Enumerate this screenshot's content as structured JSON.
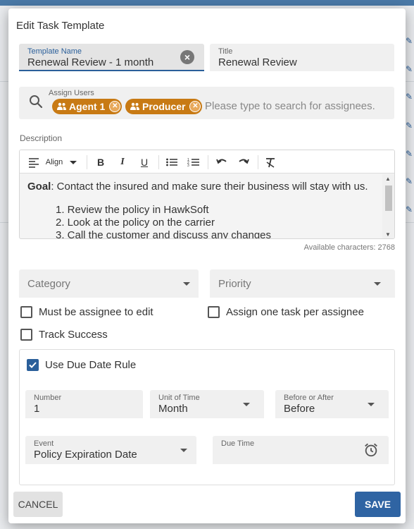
{
  "dialog": {
    "title": "Edit Task Template"
  },
  "template_name": {
    "label": "Template Name",
    "value": "Renewal Review - 1 month"
  },
  "title_field": {
    "label": "Title",
    "value": "Renewal Review"
  },
  "assign": {
    "label": "Assign Users",
    "chips": [
      "Agent 1",
      "Producer"
    ],
    "placeholder": "Please type to search for assignees."
  },
  "description": {
    "label": "Description",
    "toolbar": {
      "align_label": "Align"
    },
    "goal_label": "Goal",
    "goal_text": ": Contact the insured and make sure their business will stay with us.",
    "items": [
      "1. Review the policy in HawkSoft",
      "2. Look at the policy on the carrier",
      "3. Call the customer and discuss any changes"
    ],
    "available": "Available characters: 2768"
  },
  "category": {
    "placeholder": "Category"
  },
  "priority": {
    "placeholder": "Priority"
  },
  "checkboxes": {
    "must_be_assignee": {
      "label": "Must be assignee to edit",
      "checked": false
    },
    "one_task_per_assignee": {
      "label": "Assign one task per assignee",
      "checked": false
    },
    "track_success": {
      "label": "Track Success",
      "checked": false
    },
    "use_due_date_rule": {
      "label": "Use Due Date Rule",
      "checked": true
    }
  },
  "due_rule": {
    "number": {
      "label": "Number",
      "value": "1"
    },
    "unit": {
      "label": "Unit of Time",
      "value": "Month"
    },
    "before_after": {
      "label": "Before or After",
      "value": "Before"
    },
    "event": {
      "label": "Event",
      "value": "Policy Expiration Date"
    },
    "due_time": {
      "label": "Due Time",
      "value": ""
    }
  },
  "buttons": {
    "cancel": "CANCEL",
    "save": "SAVE"
  },
  "colors": {
    "accent": "#2f64a3",
    "chip": "#c87a14",
    "field_bg": "#f0f0f0"
  },
  "icons": [
    "search-icon",
    "clear-icon",
    "people-icon",
    "align-icon",
    "bold-icon",
    "italic-icon",
    "underline-icon",
    "bullet-list-icon",
    "numbered-list-icon",
    "undo-icon",
    "redo-icon",
    "clear-format-icon",
    "alarm-clock-icon",
    "chevron-down-icon",
    "check-icon"
  ]
}
